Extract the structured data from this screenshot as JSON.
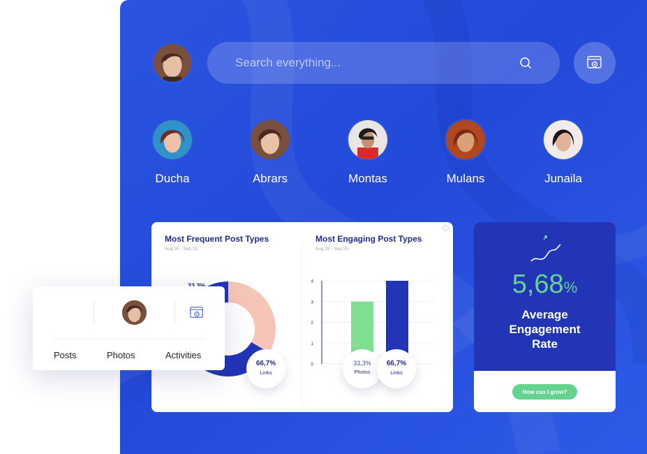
{
  "search": {
    "placeholder": "Search everything..."
  },
  "friends": [
    "Ducha",
    "Abrars",
    "Montas",
    "Mulans",
    "Junaila"
  ],
  "chart_data": [
    {
      "type": "pie",
      "title": "Most Frequent Post Types",
      "subtitle": "Aug 26 - Sep 25",
      "categories": [
        "Photos",
        "Links"
      ],
      "values": [
        33.3,
        66.7
      ],
      "value_labels": [
        "33,3%",
        "66,7%"
      ],
      "colors": [
        "#f5c6b8",
        "#2235b7"
      ]
    },
    {
      "type": "bar",
      "title": "Most Engaging Post Types",
      "subtitle": "Aug 26 - Sep 25",
      "categories": [
        "Photos",
        "Links"
      ],
      "values": [
        3,
        4
      ],
      "value_labels": [
        "33,3%",
        "66,7%"
      ],
      "ylim": [
        0,
        4
      ],
      "yticks": [
        "0",
        "1",
        "2",
        "3",
        "4"
      ],
      "colors": [
        "#7fe08f",
        "#2235b7"
      ],
      "grid": true
    }
  ],
  "engagement": {
    "value": "5,68",
    "unit": "%",
    "title": "Average Engagement Rate",
    "button": "How can I grow?"
  },
  "floating_card": {
    "tabs": [
      "Posts",
      "Photos",
      "Activities"
    ]
  },
  "colors": {
    "panel": "#2a55e0",
    "navy": "#2235b7",
    "green": "#65d38e"
  },
  "icons": [
    "search-icon",
    "settings-icon",
    "trend-arrow-icon",
    "info-icon"
  ]
}
